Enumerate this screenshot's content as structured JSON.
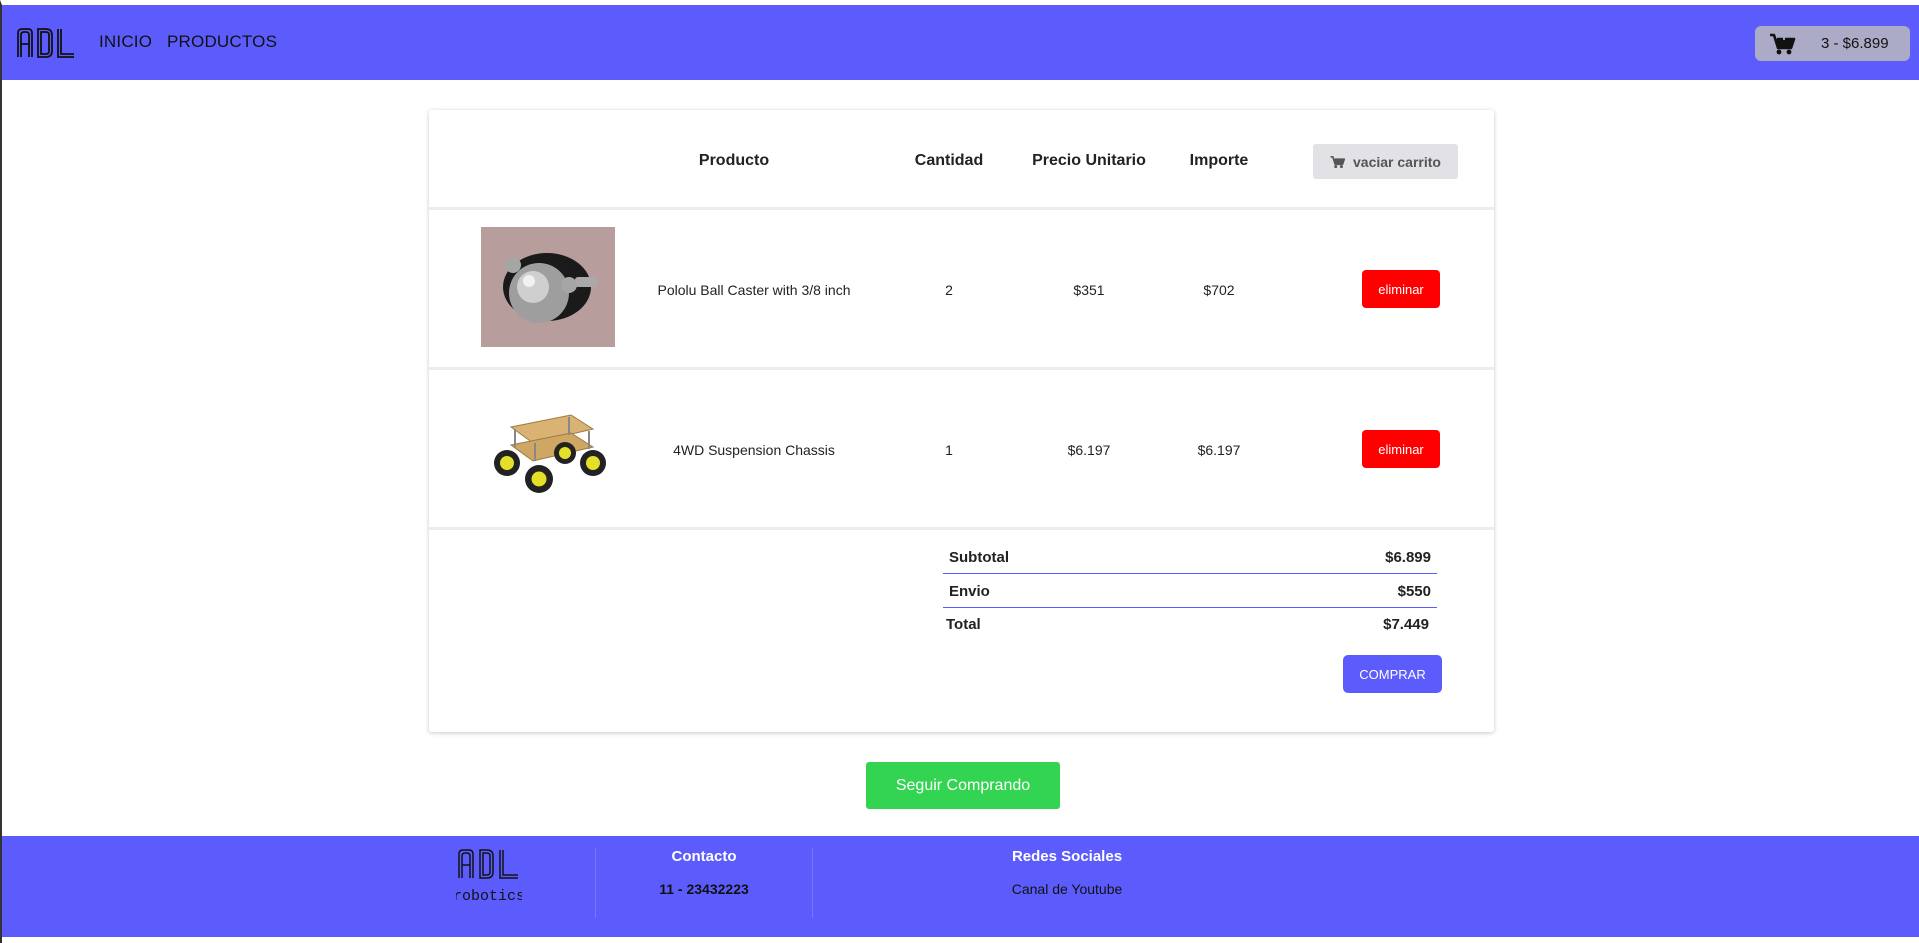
{
  "colors": {
    "brand": "#5c5cfd",
    "danger": "#fe0000",
    "success": "#33d452",
    "cart_widget_bg": "#ababc8"
  },
  "navbar": {
    "logo_text": "ADL",
    "links": [
      {
        "label": "INICIO"
      },
      {
        "label": "PRODUCTOS"
      }
    ],
    "cart": {
      "icon": "shopping-cart-icon",
      "summary": "3 - $6.899"
    }
  },
  "cart_table": {
    "headers": {
      "producto": "Producto",
      "cantidad": "Cantidad",
      "precio_unitario": "Precio Unitario",
      "importe": "Importe"
    },
    "clear_button": {
      "icon": "shopping-cart-icon",
      "label": "vaciar carrito"
    },
    "rows": [
      {
        "image": "ball-caster-image",
        "name": "Pololu Ball Caster with 3/8 inch",
        "quantity": "2",
        "unit_price": "$351",
        "amount": "$702",
        "remove_label": "eliminar"
      },
      {
        "image": "4wd-chassis-image",
        "name": "4WD Suspension Chassis",
        "quantity": "1",
        "unit_price": "$6.197",
        "amount": "$6.197",
        "remove_label": "eliminar"
      }
    ],
    "totals": {
      "subtotal_label": "Subtotal",
      "subtotal_value": "$6.899",
      "envio_label": "Envio",
      "envio_value": "$550",
      "total_label": "Total",
      "total_value": "$7.449"
    },
    "buy_label": "COMPRAR"
  },
  "continue_shopping_label": "Seguir Comprando",
  "footer": {
    "logo_text": "ADL",
    "logo_subtext": "robotics",
    "contacto_heading": "Contacto",
    "phone": "11 - 23432223",
    "redes_heading": "Redes Sociales",
    "youtube_link": "Canal de Youtube"
  }
}
